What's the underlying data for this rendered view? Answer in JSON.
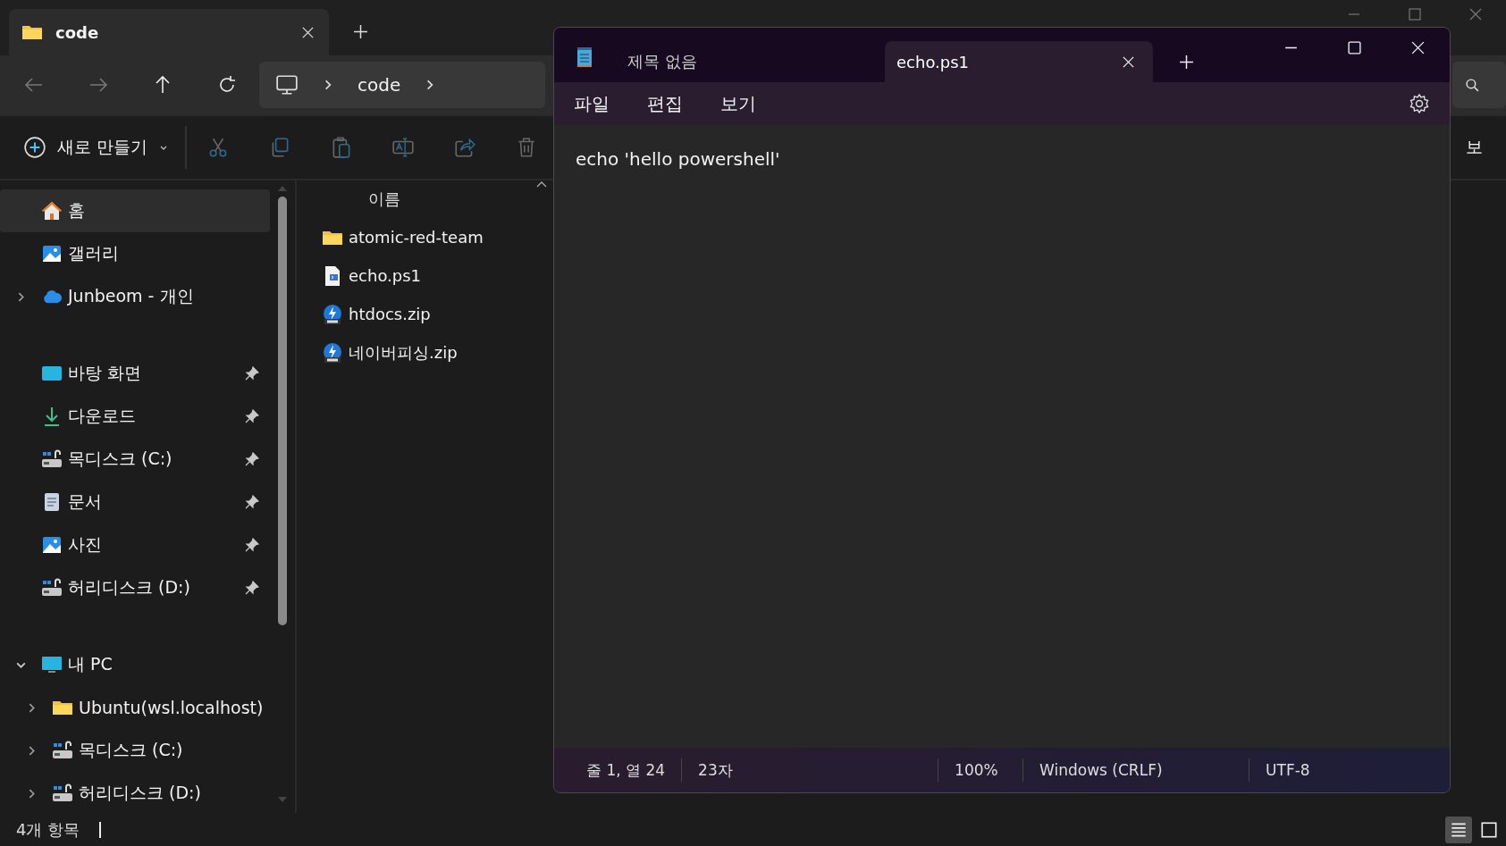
{
  "explorer": {
    "tabs": [
      {
        "title": "code",
        "selected": true
      }
    ],
    "address": {
      "segments": [
        "code"
      ]
    },
    "command_bar": {
      "new_button": "새로 만들기",
      "details_label": "보"
    },
    "sidebar": {
      "sections": [
        {
          "items": [
            {
              "label": "홈",
              "kind": "home",
              "selected": true
            },
            {
              "label": "갤러리",
              "kind": "gallery",
              "selected": false
            },
            {
              "label": "Junbeom - 개인",
              "kind": "cloud",
              "selected": false,
              "expanded": false
            }
          ]
        },
        {
          "items": [
            {
              "label": "바탕 화면",
              "kind": "desktop",
              "selected": false,
              "pinned": true
            },
            {
              "label": "다운로드",
              "kind": "download",
              "selected": false,
              "pinned": true
            },
            {
              "label": "목디스크 (C:)",
              "kind": "drive",
              "selected": false,
              "pinned": true
            },
            {
              "label": "문서",
              "kind": "documents",
              "selected": false,
              "pinned": true
            },
            {
              "label": "사진",
              "kind": "pictures",
              "selected": false,
              "pinned": true
            },
            {
              "label": "허리디스크 (D:)",
              "kind": "drive",
              "selected": false,
              "pinned": true
            }
          ]
        },
        {
          "items": [
            {
              "label": "내 PC",
              "kind": "pc",
              "selected": false,
              "expanded": true,
              "children": [
                {
                  "label": "Ubuntu(wsl.localhost)",
                  "kind": "folder",
                  "selected": false,
                  "expanded": false
                },
                {
                  "label": "목디스크 (C:)",
                  "kind": "drive",
                  "selected": false,
                  "expanded": false
                },
                {
                  "label": "허리디스크 (D:)",
                  "kind": "drive",
                  "selected": false,
                  "expanded": false
                }
              ]
            }
          ]
        }
      ]
    },
    "columns": [
      "이름"
    ],
    "files": [
      {
        "name": "atomic-red-team",
        "kind": "folder"
      },
      {
        "name": "echo.ps1",
        "kind": "script"
      },
      {
        "name": "htdocs.zip",
        "kind": "zip"
      },
      {
        "name": "네이버피싱.zip",
        "kind": "zip"
      }
    ],
    "status_bar": {
      "count": "4개 항목"
    },
    "view_buttons": [
      {
        "kind": "details",
        "selected": true
      },
      {
        "kind": "tiles",
        "selected": false
      }
    ]
  },
  "notepad": {
    "tabs": [
      {
        "title": "제목 없음",
        "selected": false
      },
      {
        "title": "echo.ps1",
        "selected": true
      }
    ],
    "menu": [
      "파일",
      "편집",
      "보기"
    ],
    "text": "echo 'hello powershell'",
    "status_bar": [
      "줄 1, 열 24",
      "23자",
      "100%",
      "Windows (CRLF)",
      "UTF-8"
    ]
  }
}
